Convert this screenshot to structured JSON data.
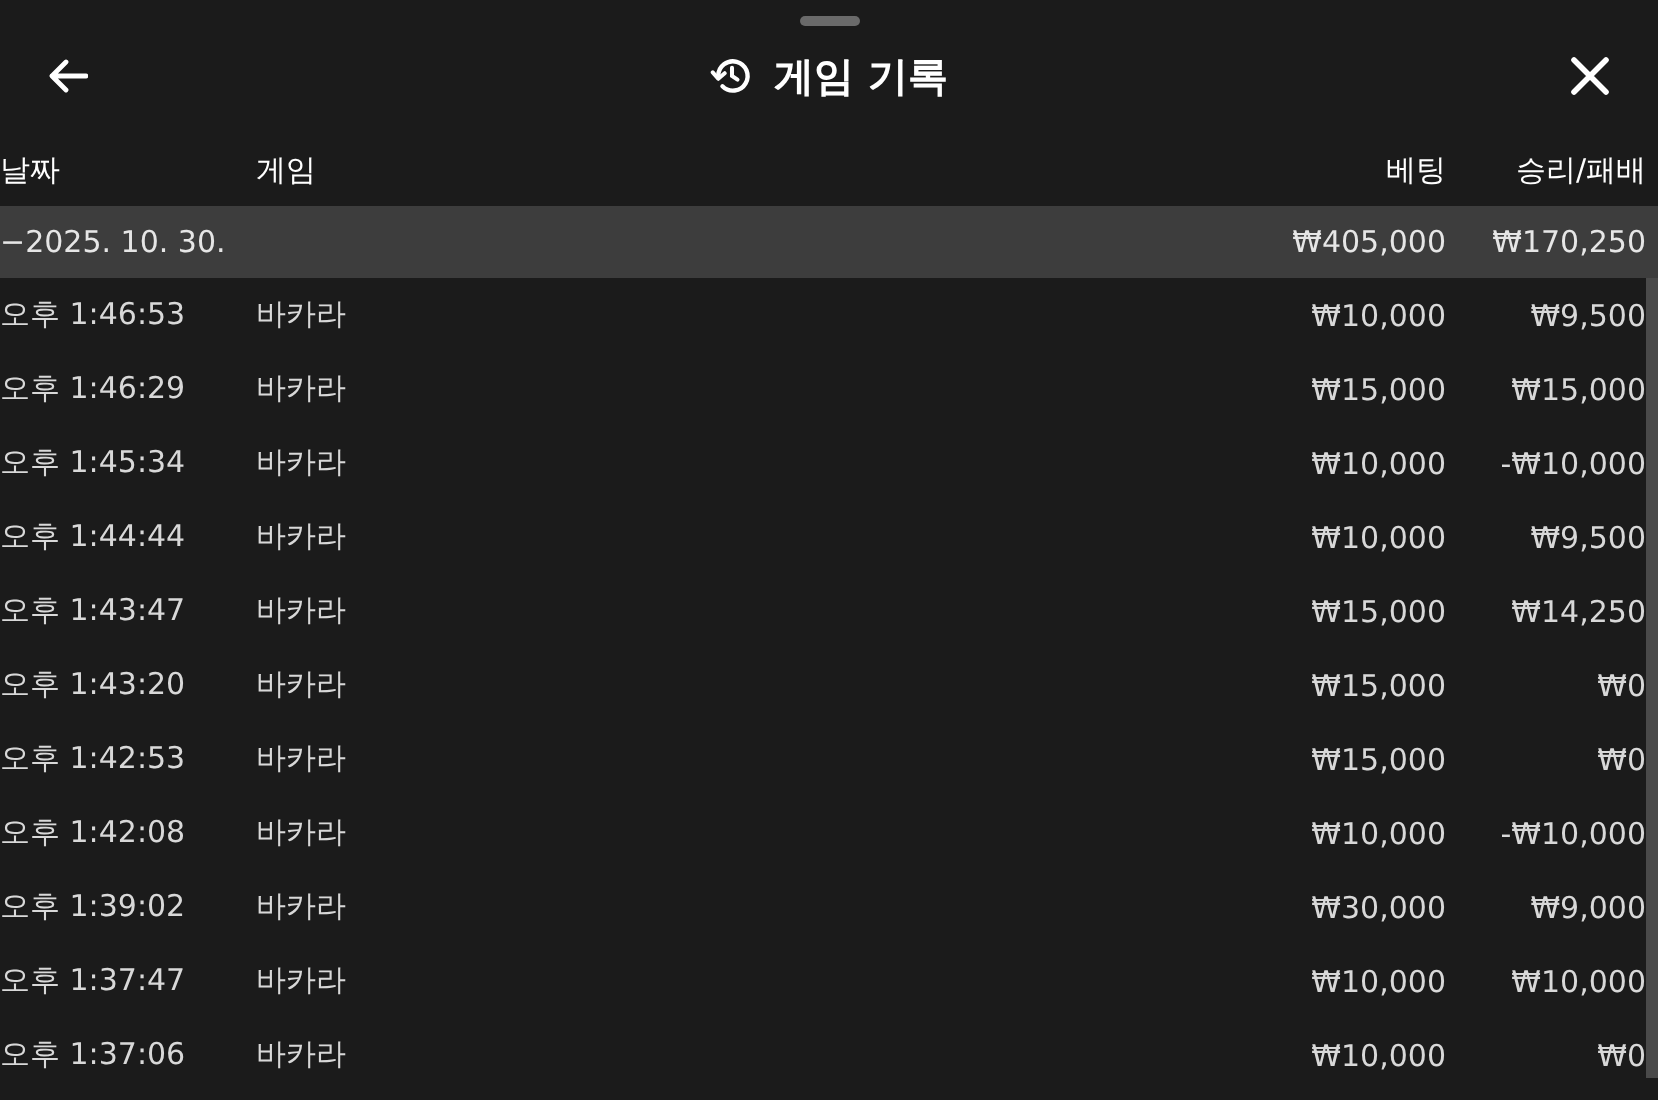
{
  "window": {
    "title": "게임 기록"
  },
  "table": {
    "columns": [
      "날짜",
      "게임",
      "베팅",
      "승리/패배"
    ],
    "group": {
      "date": "−2025. 10. 30.",
      "bet": "₩405,000",
      "result": "₩170,250"
    },
    "rows": [
      {
        "time": "오후 1:46:53",
        "game": "바카라",
        "bet": "₩10,000",
        "result": "₩9,500"
      },
      {
        "time": "오후 1:46:29",
        "game": "바카라",
        "bet": "₩15,000",
        "result": "₩15,000"
      },
      {
        "time": "오후 1:45:34",
        "game": "바카라",
        "bet": "₩10,000",
        "result": "-₩10,000"
      },
      {
        "time": "오후 1:44:44",
        "game": "바카라",
        "bet": "₩10,000",
        "result": "₩9,500"
      },
      {
        "time": "오후 1:43:47",
        "game": "바카라",
        "bet": "₩15,000",
        "result": "₩14,250"
      },
      {
        "time": "오후 1:43:20",
        "game": "바카라",
        "bet": "₩15,000",
        "result": "₩0"
      },
      {
        "time": "오후 1:42:53",
        "game": "바카라",
        "bet": "₩15,000",
        "result": "₩0"
      },
      {
        "time": "오후 1:42:08",
        "game": "바카라",
        "bet": "₩10,000",
        "result": "-₩10,000"
      },
      {
        "time": "오후 1:39:02",
        "game": "바카라",
        "bet": "₩30,000",
        "result": "₩9,000"
      },
      {
        "time": "오후 1:37:47",
        "game": "바카라",
        "bet": "₩10,000",
        "result": "₩10,000"
      },
      {
        "time": "오후 1:37:06",
        "game": "바카라",
        "bet": "₩10,000",
        "result": "₩0"
      }
    ]
  }
}
